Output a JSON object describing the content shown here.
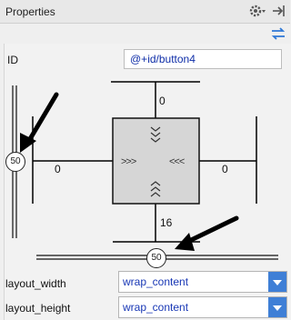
{
  "header": {
    "title": "Properties",
    "settings_icon": "gear-icon",
    "hide_icon": "pin-right-icon",
    "swap_icon": "swap-arrows-icon"
  },
  "id_field": {
    "label": "ID",
    "value": "@+id/button4"
  },
  "constraint_widget": {
    "top_margin": "0",
    "bottom_margin": "16",
    "left_margin": "0",
    "right_margin": "0",
    "vertical_bias": "50",
    "horizontal_bias": "50",
    "left_inner_marks": ">>>",
    "right_inner_marks": "<<<"
  },
  "layout_width": {
    "label": "layout_width",
    "value": "wrap_content"
  },
  "layout_height": {
    "label": "layout_height",
    "value": "wrap_content"
  },
  "colors": {
    "accent": "#3f7fd6",
    "id_text": "#0f2ea8"
  }
}
